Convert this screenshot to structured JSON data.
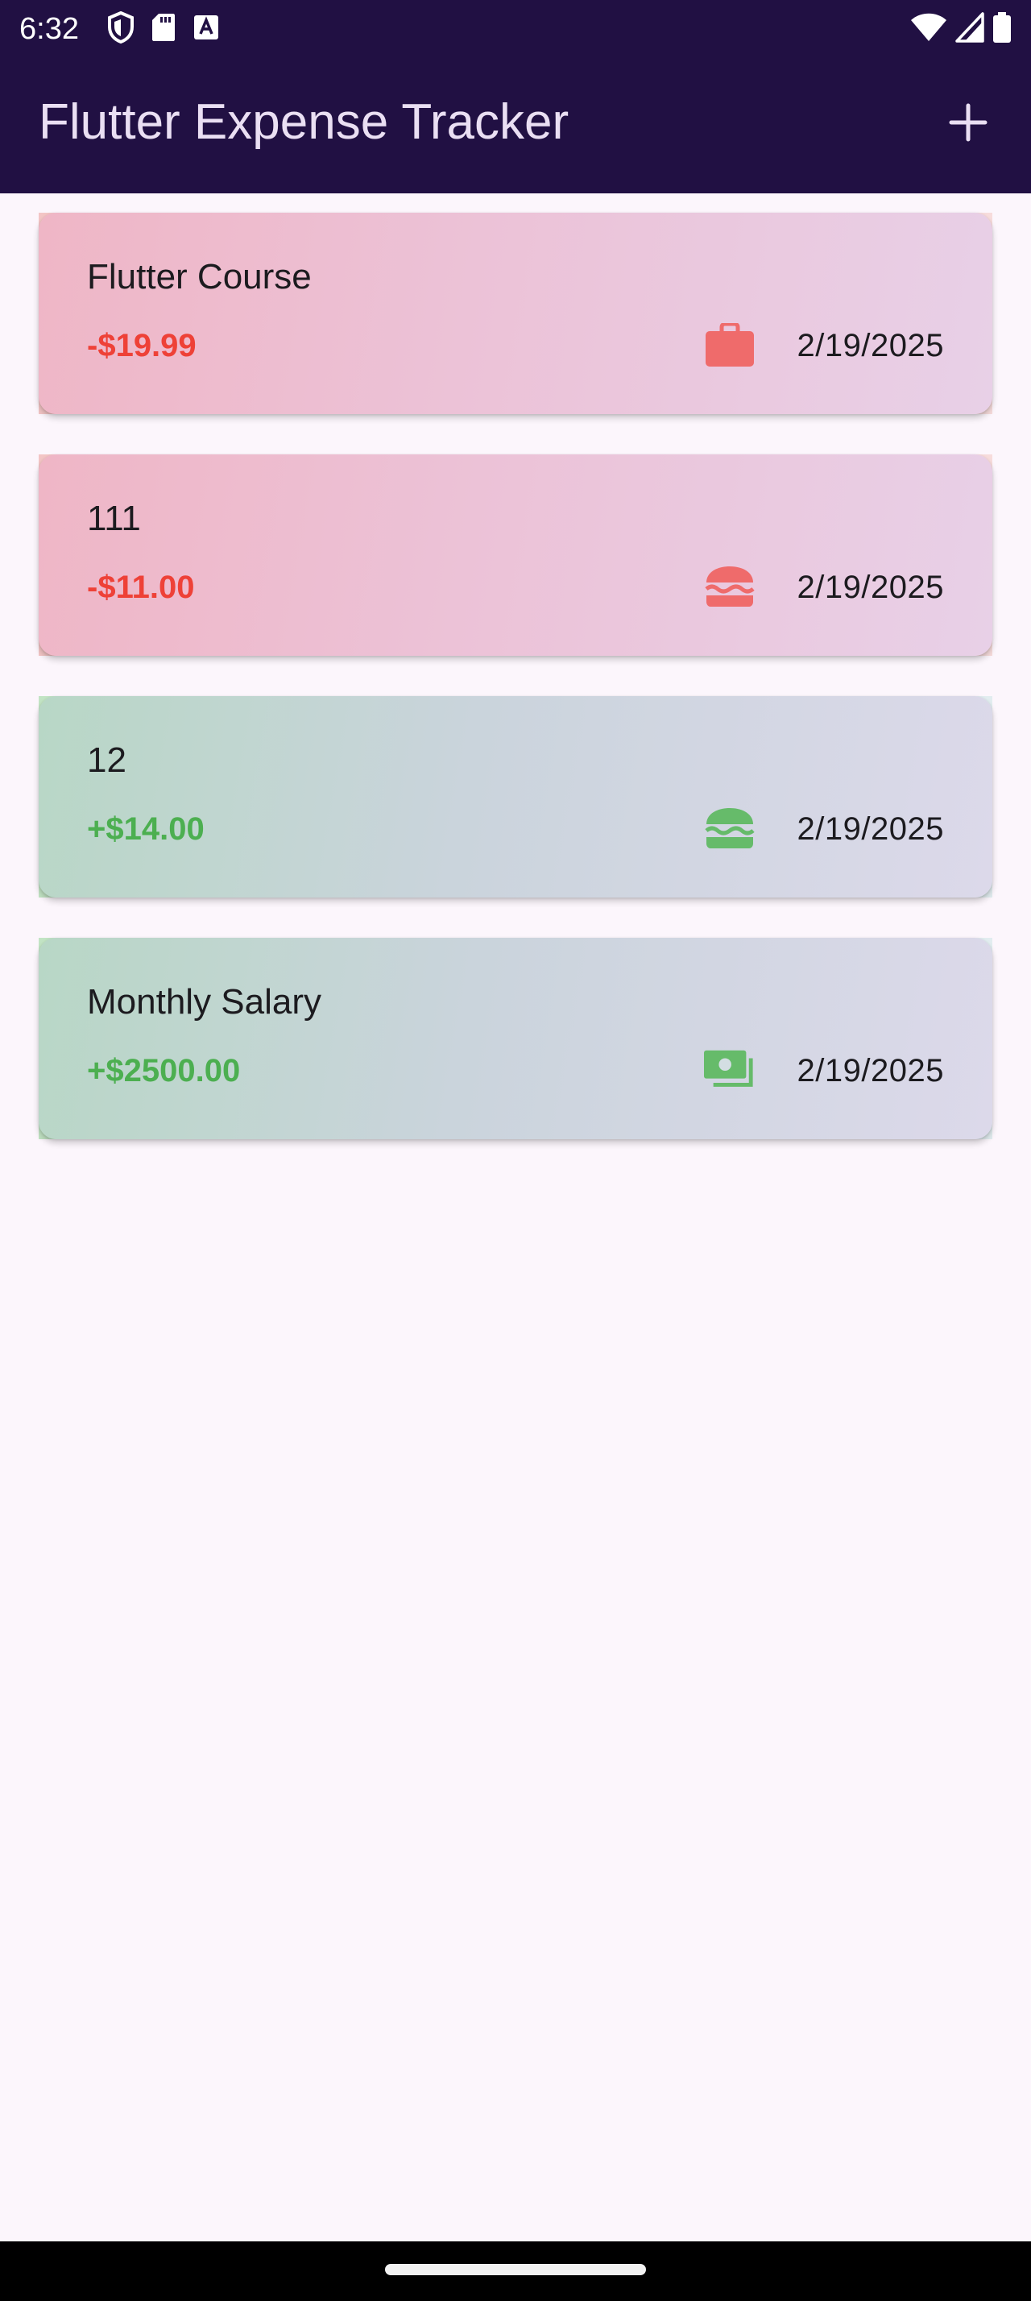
{
  "status_bar": {
    "time": "6:32",
    "left_icons": [
      "shield-icon",
      "sd-card-icon",
      "text-a-icon"
    ],
    "right_icons": [
      "wifi-icon",
      "cellular-signal-icon",
      "battery-icon"
    ]
  },
  "app_bar": {
    "title": "Flutter Expense Tracker",
    "add_icon": "add-icon"
  },
  "expenses": [
    {
      "title": "Flutter Course",
      "amount": "-$19.99",
      "type": "expense",
      "category_icon": "briefcase-icon",
      "date": "2/19/2025"
    },
    {
      "title": "111",
      "amount": "-$11.00",
      "type": "expense",
      "category_icon": "burger-icon",
      "date": "2/19/2025"
    },
    {
      "title": "12",
      "amount": "+$14.00",
      "type": "income",
      "category_icon": "burger-icon",
      "date": "2/19/2025"
    },
    {
      "title": "Monthly Salary",
      "amount": "+$2500.00",
      "type": "income",
      "category_icon": "money-bills-icon",
      "date": "2/19/2025"
    }
  ],
  "colors": {
    "header_bg": "#211043",
    "page_bg": "#fcf6fc",
    "expense_red": "#ee4137",
    "income_green": "#4caf50",
    "expense_icon": "#ef6b6b",
    "income_icon": "#66bb6a"
  }
}
